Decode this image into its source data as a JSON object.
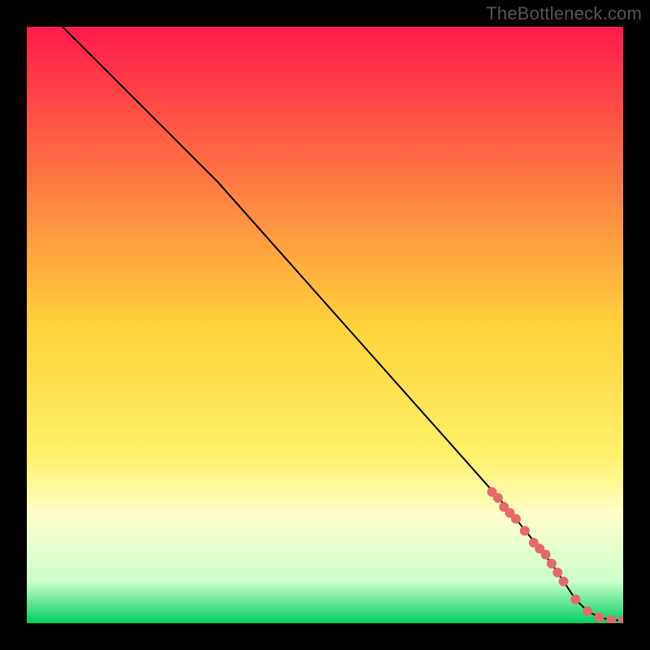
{
  "watermark": "TheBottleneck.com",
  "chart_data": {
    "type": "line",
    "title": "",
    "xlabel": "",
    "ylabel": "",
    "xlim": [
      0,
      100
    ],
    "ylim": [
      0,
      100
    ],
    "grid": false,
    "legend": false,
    "background_gradient": {
      "stops": [
        {
          "offset": 0.0,
          "color": "#ff1a4b"
        },
        {
          "offset": 0.5,
          "color": "#ffd23a"
        },
        {
          "offset": 0.72,
          "color": "#fff26a"
        },
        {
          "offset": 0.82,
          "color": "#ffffcc"
        },
        {
          "offset": 0.93,
          "color": "#ccffcc"
        },
        {
          "offset": 1.0,
          "color": "#00d060"
        }
      ]
    },
    "series": [
      {
        "name": "curve",
        "type": "line",
        "color": "#000000",
        "x": [
          6,
          12,
          18,
          24,
          28,
          32,
          40,
          48,
          56,
          64,
          72,
          80,
          84,
          88,
          90,
          92,
          94,
          96,
          98,
          100
        ],
        "y": [
          100,
          94,
          88,
          82,
          78,
          74,
          65,
          56,
          47,
          38,
          29,
          20,
          15,
          10,
          7,
          4,
          2,
          1,
          0.5,
          0.5
        ]
      },
      {
        "name": "markers",
        "type": "scatter",
        "color": "#e46a6a",
        "x": [
          78,
          79,
          80,
          81,
          82,
          83.5,
          85,
          86,
          87,
          88,
          89,
          90,
          92,
          94,
          96,
          98,
          100
        ],
        "y": [
          22,
          21,
          19.5,
          18.5,
          17.5,
          15.5,
          13.5,
          12.5,
          11.5,
          10,
          8.5,
          7,
          4,
          2,
          1,
          0.5,
          0.5
        ]
      }
    ]
  }
}
